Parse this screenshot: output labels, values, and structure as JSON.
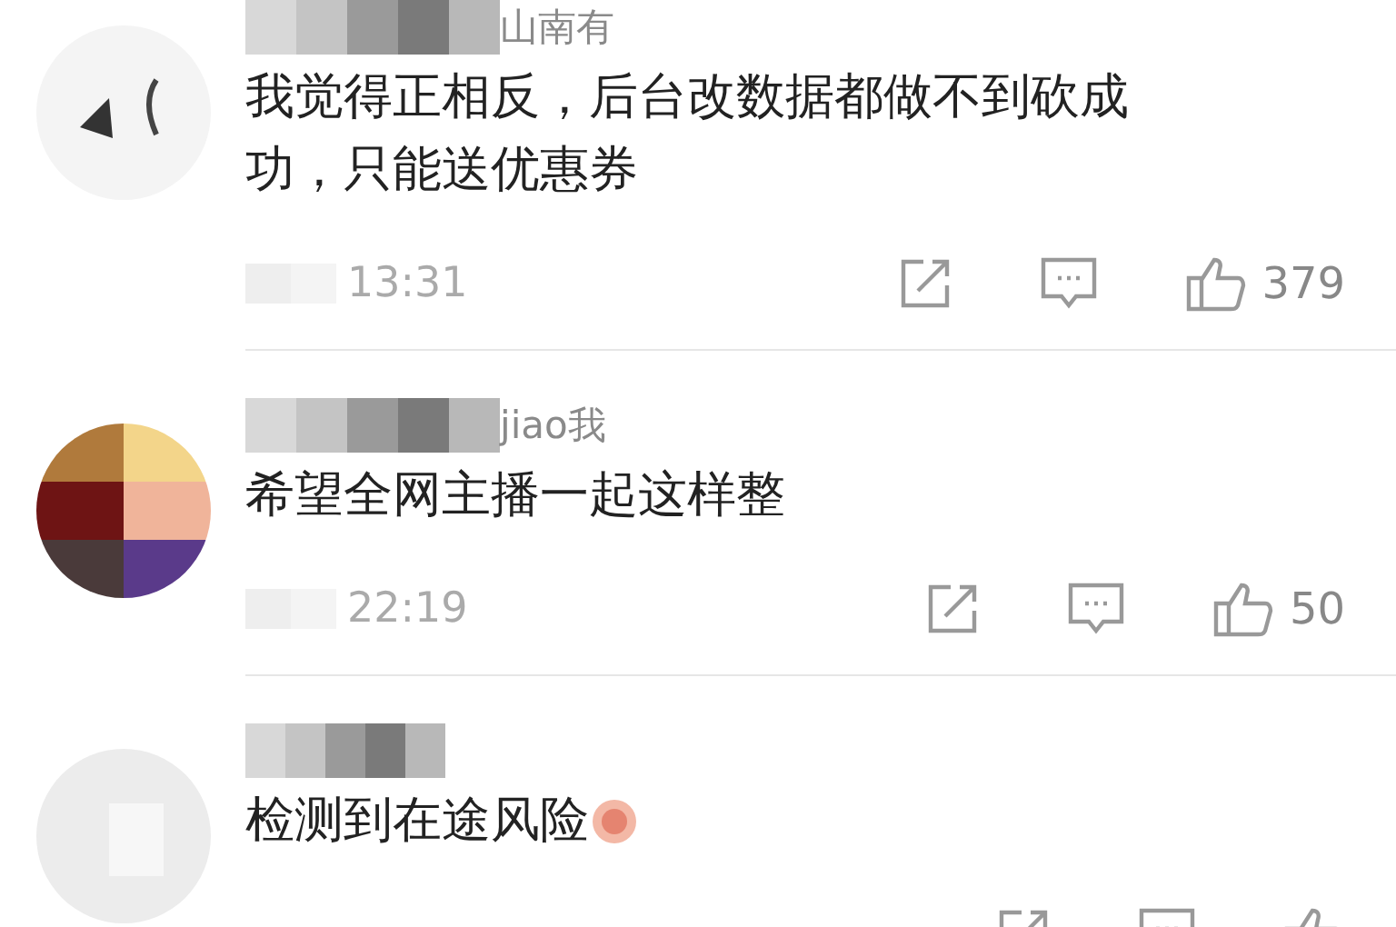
{
  "comments": [
    {
      "name_redacted": true,
      "username": "山南有",
      "text": "我觉得正相反，后台改数据都做不到砍成功，只能送优惠券",
      "emoji": false,
      "time": "13:31",
      "likes": "379"
    },
    {
      "name_redacted": true,
      "username": "jiao我",
      "text": "希望全网主播一起这样整",
      "emoji": false,
      "time": "22:19",
      "likes": "50"
    },
    {
      "name_redacted": true,
      "text": "检测到在途风险",
      "emoji": true
    }
  ]
}
